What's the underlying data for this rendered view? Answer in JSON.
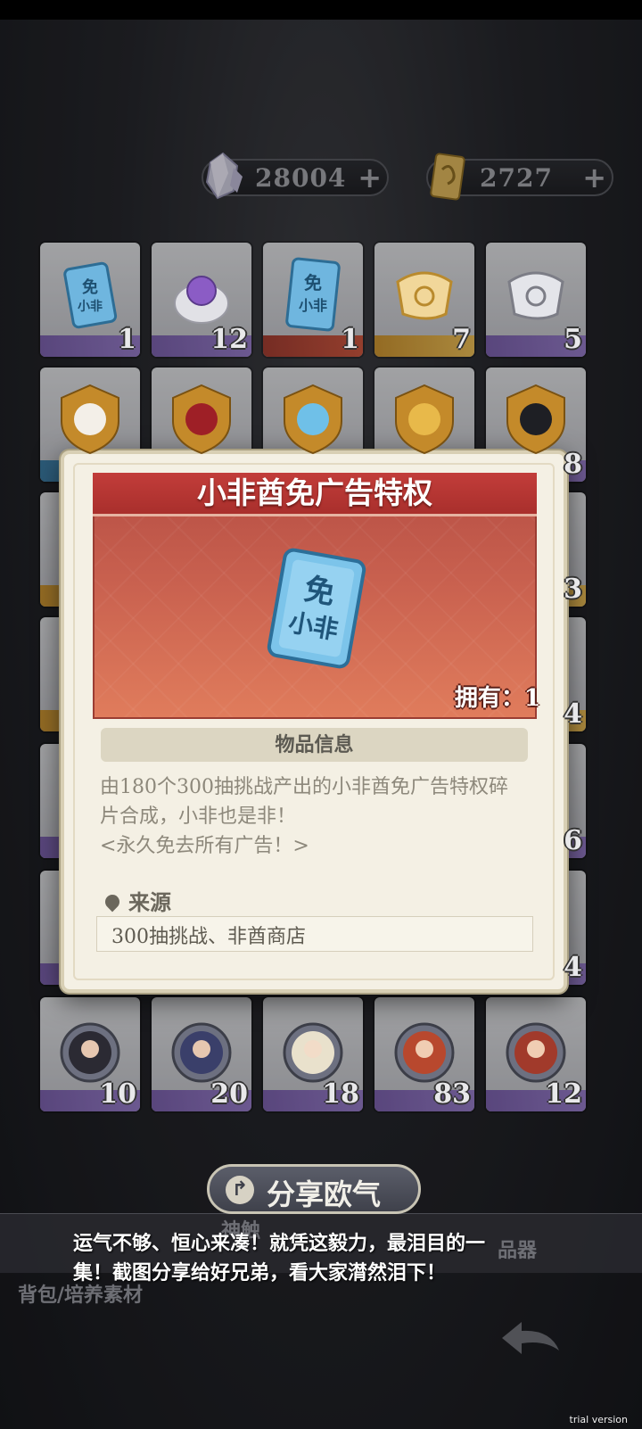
{
  "currencies": [
    {
      "icon": "crystal-icon",
      "value": "28004",
      "plus": "+"
    },
    {
      "icon": "ticket-icon",
      "value": "2727",
      "plus": "+"
    }
  ],
  "items": [
    {
      "icon": "no-ads-ticket-fragment-icon",
      "count": "1"
    },
    {
      "icon": "purple-egg-icon",
      "count": "12"
    },
    {
      "icon": "no-ads-ticket-icon",
      "count": "1"
    },
    {
      "icon": "gold-scroll-icon",
      "count": "7"
    },
    {
      "icon": "silver-scroll-icon",
      "count": "5"
    },
    {
      "icon": "white-emblem-icon",
      "count": ""
    },
    {
      "icon": "red-emblem-icon",
      "count": ""
    },
    {
      "icon": "blue-emblem-icon",
      "count": ""
    },
    {
      "icon": "gold-emblem-icon",
      "count": ""
    },
    {
      "icon": "black-emblem-icon",
      "count": "8"
    },
    {
      "icon": "portrait-medal-1-icon",
      "count": "10"
    },
    {
      "icon": "portrait-medal-2-icon",
      "count": "20"
    },
    {
      "icon": "portrait-medal-3-icon",
      "count": "18"
    },
    {
      "icon": "portrait-medal-4-icon",
      "count": "83"
    },
    {
      "icon": "portrait-medal-5-icon",
      "count": "12"
    }
  ],
  "right_edge_counts": [
    "3",
    "4",
    "6",
    "4"
  ],
  "modal": {
    "title": "小非酋免广告特权",
    "owned": "拥有：1",
    "section": "物品信息",
    "description_lines": [
      "由180个300抽挑战产出的小非酋免广告特权碎",
      "片合成，小非也是非！",
      "<永久免去所有广告！>"
    ],
    "source_label": "来源",
    "source_value": "300抽挑战、非酋商店"
  },
  "share": {
    "button_label": "分享欧气",
    "text_lines": [
      "运气不够、恒心来凑！就凭这毅力，最泪目的一",
      "集！截图分享给好兄弟，看大家潸然泪下！"
    ]
  },
  "tabs": {
    "partial_left": "神触",
    "partial_right": "品器",
    "breadcrumb": "背包/培养素材"
  },
  "watermark": "trial version",
  "colors": {
    "ribbon": "#b8302d",
    "modal_bg": "#f4f0e4",
    "rarity_purple": "#7a5fb0",
    "rarity_gold": "#d9a23a"
  }
}
